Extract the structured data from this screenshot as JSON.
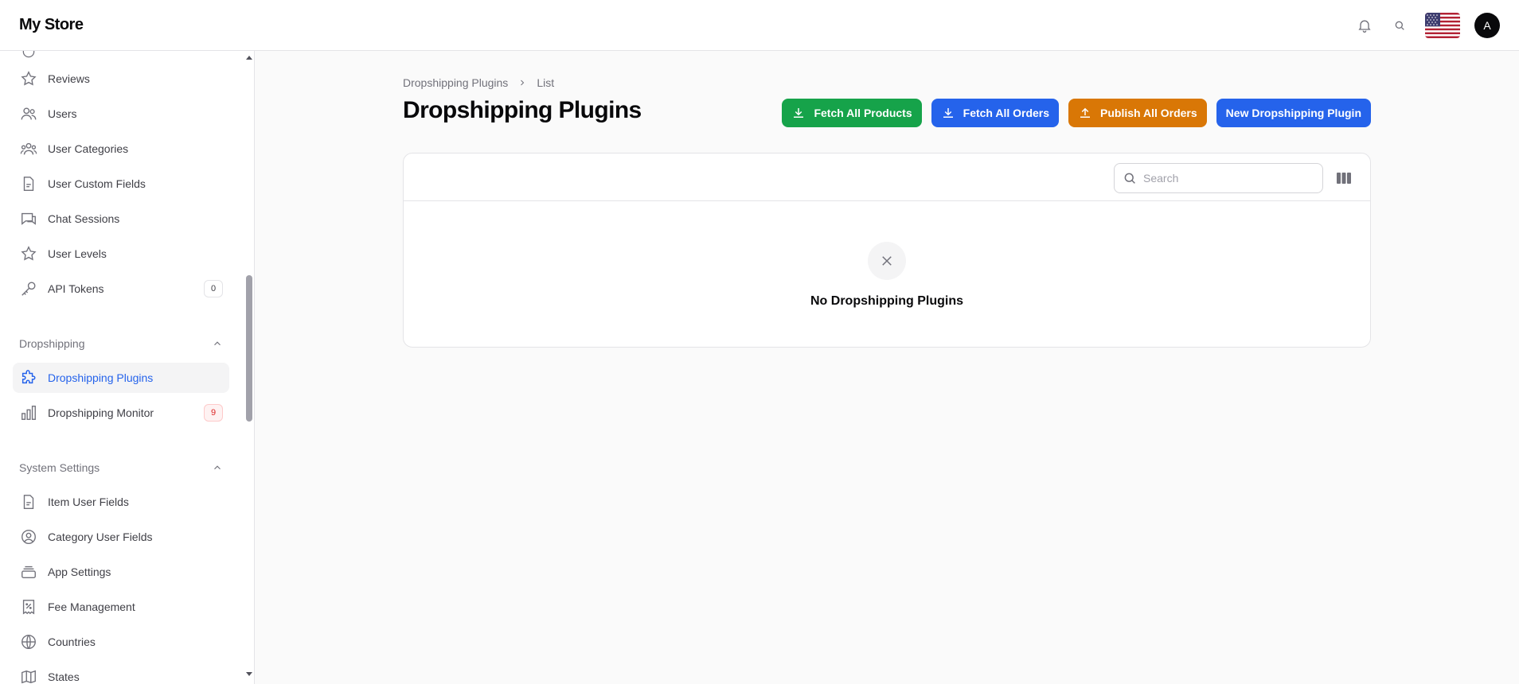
{
  "header": {
    "brand": "My Store",
    "avatar_initial": "A"
  },
  "sidebar": {
    "items_top": [
      {
        "label": "Reviews",
        "icon": "star-icon"
      },
      {
        "label": "Users",
        "icon": "users-icon"
      },
      {
        "label": "User Categories",
        "icon": "user-group-icon"
      },
      {
        "label": "User Custom Fields",
        "icon": "document-icon"
      },
      {
        "label": "Chat Sessions",
        "icon": "chat-icon"
      },
      {
        "label": "User Levels",
        "icon": "star-icon"
      },
      {
        "label": "API Tokens",
        "icon": "key-icon",
        "badge": "0"
      }
    ],
    "group_dropshipping": "Dropshipping",
    "dropshipping_items": [
      {
        "label": "Dropshipping Plugins",
        "icon": "puzzle-icon",
        "active": true
      },
      {
        "label": "Dropshipping Monitor",
        "icon": "chart-bar-icon",
        "badge": "9"
      }
    ],
    "group_system": "System Settings",
    "system_items": [
      {
        "label": "Item User Fields",
        "icon": "document-icon"
      },
      {
        "label": "Category User Fields",
        "icon": "user-circle-icon"
      },
      {
        "label": "App Settings",
        "icon": "stack-icon"
      },
      {
        "label": "Fee Management",
        "icon": "receipt-percent-icon"
      },
      {
        "label": "Countries",
        "icon": "globe-icon"
      },
      {
        "label": "States",
        "icon": "map-icon"
      }
    ]
  },
  "main": {
    "breadcrumb": [
      "Dropshipping Plugins",
      "List"
    ],
    "title": "Dropshipping Plugins",
    "actions": {
      "fetch_products": "Fetch All Products",
      "fetch_orders": "Fetch All Orders",
      "publish_orders": "Publish All Orders",
      "new_plugin": "New Dropshipping Plugin"
    },
    "table": {
      "search_placeholder": "Search",
      "empty_text": "No Dropshipping Plugins"
    }
  },
  "colors": {
    "green": "#16a34a",
    "blue": "#2563eb",
    "orange": "#d97706",
    "active_text": "#2563eb"
  }
}
